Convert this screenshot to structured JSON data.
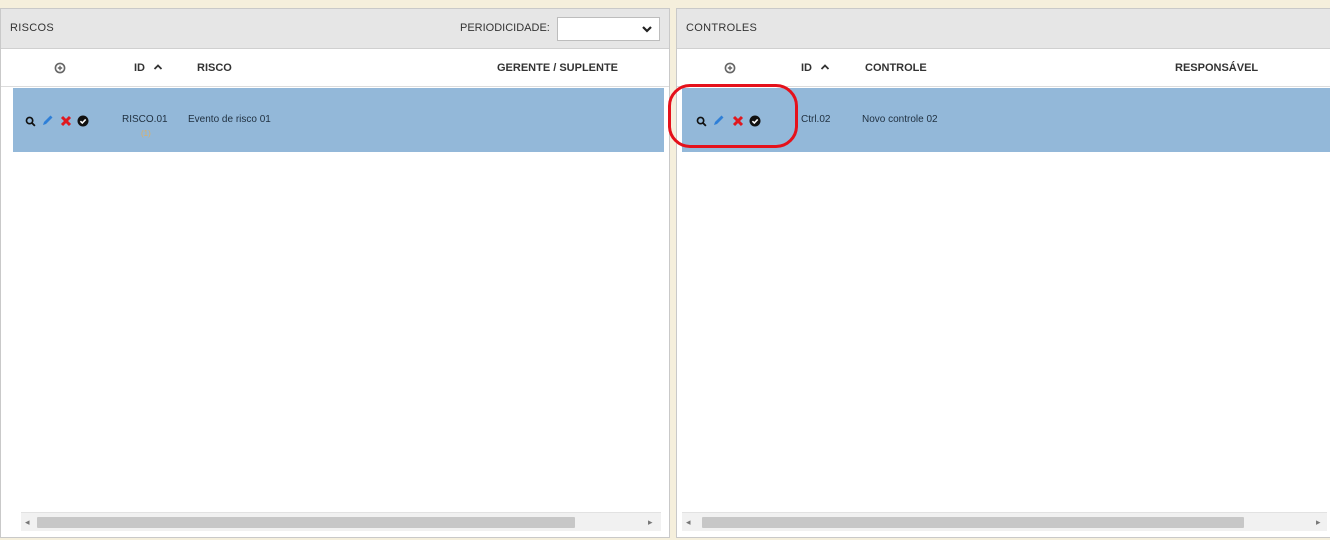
{
  "riscos": {
    "title": "RISCOS",
    "periodicidade_label": "PERIODICIDADE:",
    "periodicidade_value": "",
    "columns": {
      "id": "ID",
      "risco": "RISCO",
      "gerente": "GERENTE / SUPLENTE"
    },
    "rows": [
      {
        "id": "RISCO.01",
        "sub": "(1)",
        "risco": "Evento de risco 01",
        "gerente": ""
      }
    ]
  },
  "controles": {
    "title": "CONTROLES",
    "columns": {
      "id": "ID",
      "controle": "CONTROLE",
      "responsavel": "RESPONSÁVEL"
    },
    "rows": [
      {
        "id": "Ctrl.02",
        "controle": "Novo controle 02",
        "responsavel": ""
      }
    ]
  },
  "colors": {
    "selected_row": "#93b8d9",
    "edit_icon": "#2e7fd8",
    "delete_icon": "#e0181f",
    "highlight_ring": "#e5111b"
  },
  "icons": [
    "plus-circle-icon",
    "sort-asc-icon",
    "search-icon",
    "pencil-icon",
    "delete-x-icon",
    "check-circle-icon",
    "chevron-down-icon",
    "arrow-left-icon",
    "arrow-right-icon"
  ]
}
